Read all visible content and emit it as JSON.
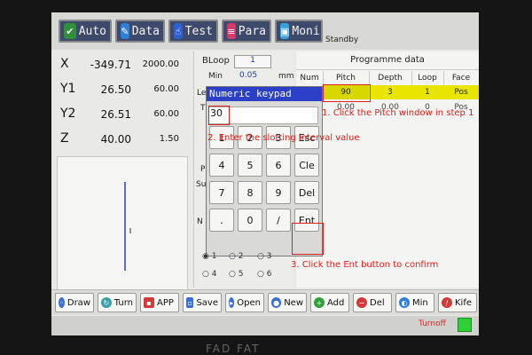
{
  "tabs": [
    {
      "label": "Auto",
      "icon": "check-icon",
      "color": "#2f8f3a"
    },
    {
      "label": "Data",
      "icon": "pencil-icon",
      "color": "#2f7fd6"
    },
    {
      "label": "Test",
      "icon": "hand-icon",
      "color": "#2d5fd0"
    },
    {
      "label": "Para",
      "icon": "sliders-icon",
      "color": "#d23a6a"
    },
    {
      "label": "Moni",
      "icon": "monitor-icon",
      "color": "#3aa0d8"
    }
  ],
  "status_text": "Standby",
  "coordinates": [
    {
      "axis": "X",
      "value": "-349.71",
      "limit": "2000.00"
    },
    {
      "axis": "Y1",
      "value": "26.50",
      "limit": "60.00"
    },
    {
      "axis": "Y2",
      "value": "26.51",
      "limit": "60.00"
    },
    {
      "axis": "Z",
      "value": "40.00",
      "limit": "1.50"
    }
  ],
  "bloop": {
    "label": "BLoop",
    "value": "1"
  },
  "min": {
    "label": "Min",
    "value": "0.05",
    "unit": "mm"
  },
  "side_fragments": {
    "le": "Le",
    "t": "T",
    "p": "P",
    "su": "Su",
    "n": "N"
  },
  "programme": {
    "title": "Programme data",
    "headers": [
      "Num",
      "Pitch",
      "Depth",
      "Loop",
      "Face"
    ],
    "row1": [
      "",
      "90",
      "3",
      "1",
      "Pos"
    ],
    "row2": [
      "",
      "0.00",
      "0.00",
      "0",
      "Pos"
    ]
  },
  "keypad": {
    "title": "Numeric keypad",
    "input_value": "30",
    "keys": [
      "1",
      "2",
      "3",
      "Esc",
      "4",
      "5",
      "6",
      "Cle",
      "7",
      "8",
      "9",
      "Del",
      ".",
      "0",
      "/",
      "Ent"
    ]
  },
  "radios": [
    "1",
    "2",
    "3",
    "4",
    "5",
    "6"
  ],
  "annotations": {
    "step1": "1. Click the Pitch window in step 1",
    "step2": "2. Enter the slotting interval value",
    "step3": "3. Click the Ent button to confirm"
  },
  "toolbar": [
    {
      "label": "Draw",
      "icon": "draw-icon",
      "color": "#3b6fd0"
    },
    {
      "label": "Turn",
      "icon": "turn-icon",
      "color": "#3aa0a8"
    },
    {
      "label": "APP",
      "icon": "app-icon",
      "color": "#d03a3a"
    },
    {
      "label": "Save",
      "icon": "save-icon",
      "color": "#3b6fd0"
    },
    {
      "label": "Open",
      "icon": "open-icon",
      "color": "#3b6fd0"
    },
    {
      "label": "New",
      "icon": "new-icon",
      "color": "#3b6fd0"
    },
    {
      "label": "Add",
      "icon": "plus-icon",
      "color": "#2f9f3a"
    },
    {
      "label": "Del",
      "icon": "minus-icon",
      "color": "#d03a3a"
    },
    {
      "label": "Min",
      "icon": "min-icon",
      "color": "#2f7fd6"
    },
    {
      "label": "Kife",
      "icon": "knife-icon",
      "color": "#d03a3a"
    }
  ],
  "turnoff": "Turnoff",
  "brand": "FAD FAT"
}
